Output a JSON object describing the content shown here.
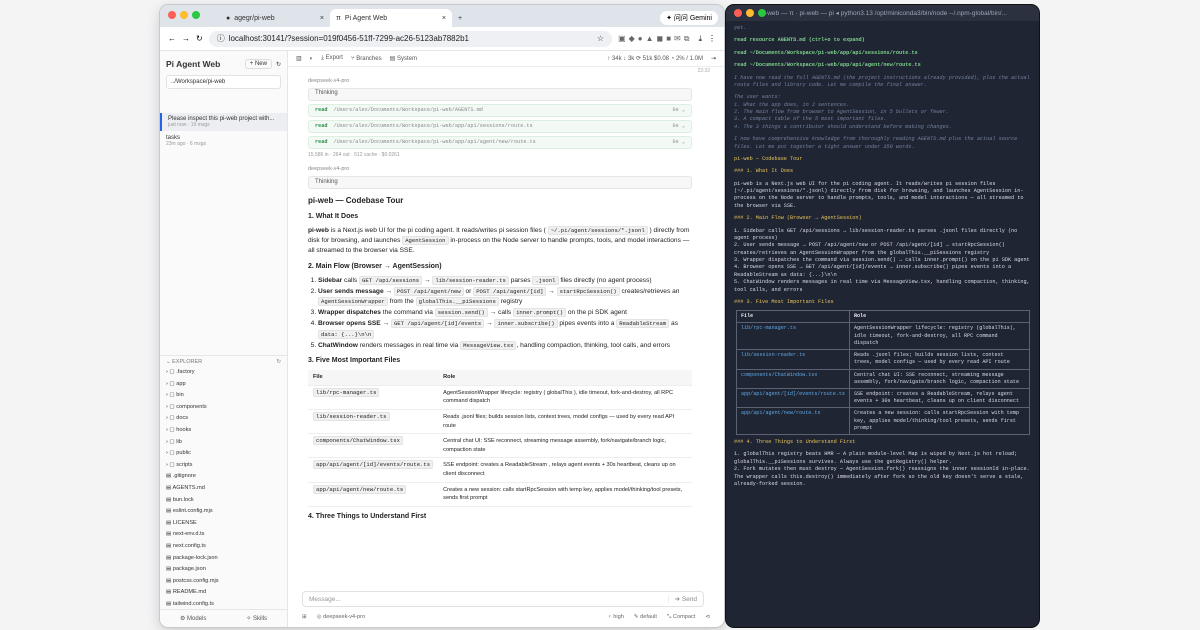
{
  "browser": {
    "tabs": [
      {
        "label": "agegr/pi-web"
      },
      {
        "label": "Pi Agent Web"
      }
    ],
    "url": "localhost:30141/?session=019f0456-51ff-7299-ac26-5123ab7882b1",
    "gemini_label": "问问 Gemini"
  },
  "sidebar": {
    "title": "Pi Agent Web",
    "new_label": "+ New",
    "path": "../Workspace/pi-web",
    "sessions": [
      {
        "title": "Please inspect this pi-web project with...",
        "meta": "just now · 19 msgs"
      },
      {
        "title": "tasks",
        "meta": "23m ago · 6 msgs"
      }
    ],
    "explorer_label": "EXPLORER",
    "files": [
      ".factory",
      "app",
      "bin",
      "components",
      "docs",
      "hooks",
      "lib",
      "public",
      "scripts",
      ".gitignore",
      "AGENTS.md",
      "bun.lock",
      "eslint.config.mjs",
      "LICENSE",
      "next-env.d.ts",
      "next.config.ts",
      "package-lock.json",
      "package.json",
      "postcss.config.mjs",
      "README.md",
      "tailwind.config.ts"
    ],
    "models_label": "Models",
    "skills_label": "Skills"
  },
  "toolbar": {
    "export_label": "Export",
    "branches_label": "Branches",
    "system_label": "System",
    "stats": "↑ 34k  ↓ 3k  ⟳ 51k  $0.08  ◔ 2% / 1.0M",
    "time": "22:32"
  },
  "chat": {
    "model_a": "deepseek-v4-pro",
    "thinking_label": "Thinking",
    "reads": [
      {
        "tag": "read",
        "path": "/Users/alex/Documents/Workspace/pi-web/AGENTS.md",
        "time": "0s"
      },
      {
        "tag": "read",
        "path": "/Users/alex/Documents/Workspace/pi-web/app/api/sessions/route.ts",
        "time": "0s"
      },
      {
        "tag": "read",
        "path": "/Users/alex/Documents/Workspace/pi-web/app/api/agent/new/route.ts",
        "time": "0s"
      }
    ],
    "usage": "15,586 in · 264 out · 512 cache · $0.0261",
    "heading": "pi-web — Codebase Tour",
    "s1": "1. What It Does",
    "s1_p1": "pi-web",
    "s1_p2": " is a Next.js web UI for the pi coding agent. It reads/writes pi session files ( ",
    "s1_code1": "~/.pi/agent/sessions/*.jsonl",
    "s1_p3": " ) directly from disk for browsing, and launches ",
    "s1_code2": "AgentSession",
    "s1_p4": " in-process on the Node server to handle prompts, tools, and model interactions — all streamed to the browser via SSE.",
    "s2": "2. Main Flow (Browser → AgentSession)",
    "s3": "3. Five Most Important Files",
    "th_file": "File",
    "th_role": "Role",
    "files": [
      {
        "file": "lib/rpc-manager.ts",
        "role": "AgentSessionWrapper lifecycle: registry ( globalThis ), idle timeout, fork-and-destroy, all RPC command dispatch"
      },
      {
        "file": "lib/session-reader.ts",
        "role": "Reads .jsonl files; builds session lists, context trees, model configs — used by every read API route"
      },
      {
        "file": "components/ChatWindow.tsx",
        "role": "Central chat UI: SSE reconnect, streaming message assembly, fork/navigate/branch logic, compaction state"
      },
      {
        "file": "app/api/agent/[id]/events/route.ts",
        "role": "SSE endpoint: creates a ReadableStream , relays agent events + 30s heartbeat, cleans up on client disconnect"
      },
      {
        "file": "app/api/agent/new/route.ts",
        "role": "Creates a new session: calls startRpcSession with temp key, applies model/thinking/tool presets, sends first prompt"
      }
    ],
    "s4": "4. Three Things to Understand First",
    "input_placeholder": "Message...",
    "send_label": "Send",
    "footer_model": "deepseek-v4-pro",
    "footer_think": "high",
    "footer_default": "default",
    "footer_compact": "Compact"
  },
  "terminal": {
    "title": "pi-web — π · pi-web — pi ◂ python3.13 /opt/miniconda3/bin/node --/.npm-global/bin/...",
    "lines": [
      {
        "c": "tdim",
        "t": "yet."
      },
      {
        "c": "",
        "t": ""
      },
      {
        "c": "tg",
        "t": "read resource AGENTS.md (ctrl+o to expand)"
      },
      {
        "c": "",
        "t": ""
      },
      {
        "c": "tg",
        "t": "read ~/Documents/Workspace/pi-web/app/api/sessions/route.ts"
      },
      {
        "c": "",
        "t": ""
      },
      {
        "c": "tg",
        "t": "read ~/Documents/Workspace/pi-web/app/api/agent/new/route.ts"
      },
      {
        "c": "",
        "t": ""
      },
      {
        "c": "tdim",
        "t": "I have now read the full AGENTS.md (the project instructions already provided), plus the actual route files and library code. Let me compile the final answer."
      },
      {
        "c": "",
        "t": ""
      },
      {
        "c": "tdim",
        "t": "The user wants:"
      },
      {
        "c": "tdim",
        "t": "1. What the app does, in 2 sentences."
      },
      {
        "c": "tdim",
        "t": "2. The main flow from browser to AgentSession, in 5 bullets or fewer."
      },
      {
        "c": "tdim",
        "t": "3. A compact table of the 5 most important files."
      },
      {
        "c": "tdim",
        "t": "4. The 3 things a contributor should understand before making changes."
      },
      {
        "c": "",
        "t": ""
      },
      {
        "c": "tdim",
        "t": "I now have comprehensive knowledge from thoroughly reading AGENTS.md plus the actual source files. Let me put together a tight answer under 350 words."
      },
      {
        "c": "",
        "t": ""
      },
      {
        "c": "ty",
        "t": "pi-web — Codebase Tour"
      },
      {
        "c": "",
        "t": ""
      },
      {
        "c": "ty",
        "t": "### 1. What It Does"
      },
      {
        "c": "",
        "t": ""
      },
      {
        "c": "",
        "t": "pi-web is a Next.js web UI for the pi coding agent. It reads/writes pi session files (~/.pi/agent/sessions/*.jsonl) directly from disk for browsing, and launches AgentSession in-process on the Node server to handle prompts, tools, and model interactions — all streamed to the browser via SSE."
      },
      {
        "c": "",
        "t": ""
      },
      {
        "c": "ty",
        "t": "### 2. Main Flow (Browser → AgentSession)"
      },
      {
        "c": "",
        "t": ""
      },
      {
        "c": "",
        "t": "1. Sidebar calls GET /api/sessions → lib/session-reader.ts parses .jsonl files directly (no agent process)"
      },
      {
        "c": "",
        "t": "2. User sends message → POST /api/agent/new or POST /api/agent/[id] → startRpcSession() creates/retrieves an AgentSessionWrapper from the globalThis.__piSessions registry"
      },
      {
        "c": "",
        "t": "3. Wrapper dispatches the command via session.send() → calls inner.prompt() on the pi SDK agent"
      },
      {
        "c": "",
        "t": "4. Browser opens SSE → GET /api/agent/[id]/events → inner.subscribe() pipes events into a ReadableStream as data: {...}\\n\\n"
      },
      {
        "c": "",
        "t": "5. ChatWindow renders messages in real time via MessageView.tsx, handling compaction, thinking, tool calls, and errors"
      },
      {
        "c": "",
        "t": ""
      },
      {
        "c": "ty",
        "t": "### 3. Five Most Important Files"
      }
    ],
    "th_file": "File",
    "th_role": "Role",
    "rows": [
      {
        "file": "lib/rpc-manager.ts",
        "role": "AgentSessionWrapper lifecycle: registry (globalThis), idle timeout, fork-and-destroy, all RPC command dispatch"
      },
      {
        "file": "lib/session-reader.ts",
        "role": "Reads .jsonl files; builds session lists, context trees, model configs — used by every read API route"
      },
      {
        "file": "components/ChatWindow.tsx",
        "role": "Central chat UI: SSE reconnect, streaming message assembly, fork/navigate/branch logic, compaction state"
      },
      {
        "file": "app/api/agent/[id]/events/route.ts",
        "role": "SSE endpoint: creates a ReadableStream, relays agent events + 30s heartbeat, cleans up on client disconnect"
      },
      {
        "file": "app/api/agent/new/route.ts",
        "role": "Creates a new session: calls startRpcSession with temp key, applies model/thinking/tool presets, sends first prompt"
      }
    ],
    "tail": [
      {
        "c": "ty",
        "t": "### 4. Three Things to Understand First"
      },
      {
        "c": "",
        "t": ""
      },
      {
        "c": "",
        "t": "1. globalThis registry beats HMR — A plain module-level Map is wiped by Next.js hot reload; globalThis.__piSessions survives. Always use the getRegistry() helper."
      },
      {
        "c": "",
        "t": "2. Fork mutates then must destroy — AgentSession.fork() reassigns the inner sessionId in-place. The wrapper calls this.destroy() immediately after fork so the old key doesn't serve a stale, already-forked session."
      }
    ]
  },
  "colors": {
    "accent": "#2563eb",
    "term_bg": "#1f2533",
    "read_green": "#2a8a44"
  }
}
